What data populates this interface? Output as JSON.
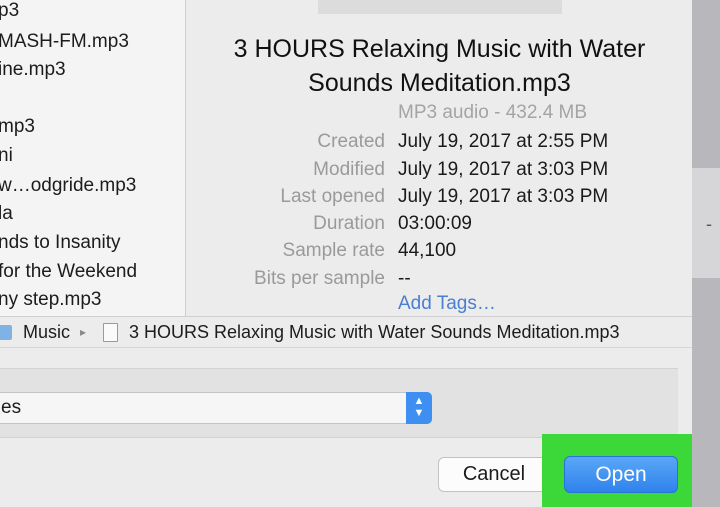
{
  "file_list": {
    "items": [
      "p3",
      "MASH-FM.mp3",
      "ine.mp3",
      "",
      "mp3",
      "ni",
      "w…odgride.mp3",
      "la",
      "nds to Insanity",
      " for the Weekend",
      "ny step.mp3"
    ]
  },
  "preview": {
    "title_line1": "3 HOURS Relaxing Music with Water",
    "title_line2": "Sounds Meditation.mp3",
    "kind": "MP3 audio - 432.4 MB",
    "meta": [
      {
        "label": "Created",
        "value": "July 19, 2017 at 2:55 PM"
      },
      {
        "label": "Modified",
        "value": "July 19, 2017 at 3:03 PM"
      },
      {
        "label": "Last opened",
        "value": "July 19, 2017 at 3:03 PM"
      },
      {
        "label": "Duration",
        "value": "03:00:09"
      },
      {
        "label": "Sample rate",
        "value": "44,100"
      },
      {
        "label": "Bits per sample",
        "value": "--"
      }
    ],
    "add_tags": "Add Tags…"
  },
  "path_bar": {
    "folder": "Music",
    "separator": "▸",
    "file": "3 HOURS Relaxing Music with Water Sounds Meditation.mp3"
  },
  "options": {
    "enable_select_value": "es"
  },
  "buttons": {
    "cancel": "Cancel",
    "open": "Open"
  },
  "colors": {
    "accent": "#3f8ff2",
    "highlight": "#3cd83a",
    "link": "#4a7fd0"
  },
  "icons": {
    "folder": "folder-icon",
    "document": "document-icon",
    "stepper": "chevron-up-down-icon"
  }
}
